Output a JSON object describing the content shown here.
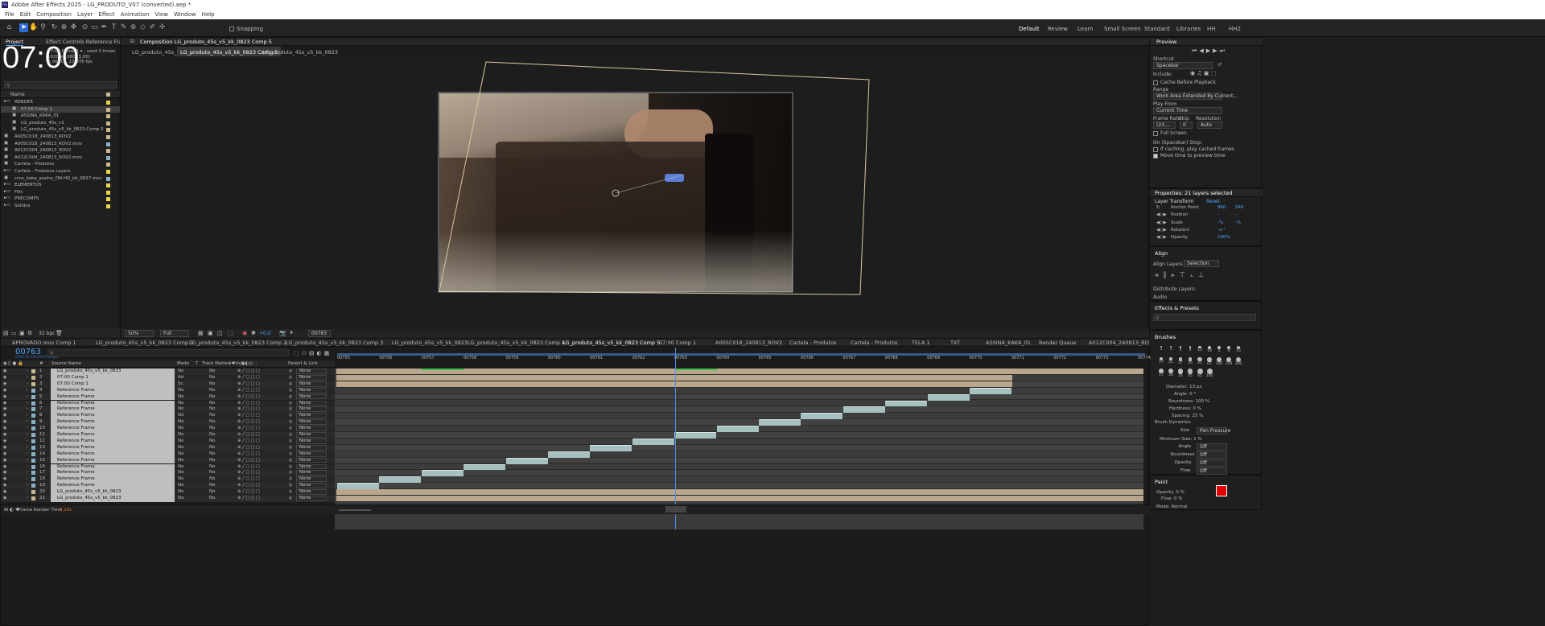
{
  "app": {
    "title": "Adobe After Effects 2025 - LG_PRODUTO_V07 (converted).aep *",
    "logo": "Ae"
  },
  "menu": [
    "File",
    "Edit",
    "Composition",
    "Layer",
    "Effect",
    "Animation",
    "View",
    "Window",
    "Help"
  ],
  "toolbar": {
    "snapping": "Snapping"
  },
  "workspaces": [
    "Default",
    "Review",
    "Learn",
    "Small Screen",
    "Standard",
    "Libraries",
    "HH",
    "HH2"
  ],
  "project": {
    "tabs": [
      "Project",
      "Effect Controls Reference Frame"
    ],
    "timecode": "07:00",
    "info": [
      "07:00 Comp 1 ▾ , used 2 times",
      "1920 x 1080 (1,00)",
      "Δ 00019, 23,976 fps"
    ],
    "col_name": "Name",
    "items": [
      {
        "name": "RENDER",
        "indent": 0,
        "color": "#e8d44d",
        "sel": false
      },
      {
        "name": "07:00 Comp 1",
        "indent": 1,
        "color": "#c9b98d",
        "sel": true
      },
      {
        "name": "ASSINA_KAKA_01",
        "indent": 1,
        "color": "#c9b98d",
        "sel": false
      },
      {
        "name": "LG_produto_45s_v1",
        "indent": 1,
        "color": "#c9b98d",
        "sel": false
      },
      {
        "name": "LG_produto_45s_v5_kk_0823 Comp 5",
        "indent": 1,
        "color": "#c9b98d",
        "sel": false
      },
      {
        "name": "A005C018_240813_ROV2",
        "indent": 0,
        "color": "#c9b98d",
        "sel": false
      },
      {
        "name": "A005C018_240813_ROV2.mov",
        "indent": 0,
        "color": "#8ab0c8",
        "sel": false
      },
      {
        "name": "A012C004_240813_ROV2",
        "indent": 0,
        "color": "#c9b98d",
        "sel": false
      },
      {
        "name": "A012C004_240813_ROV2.mov",
        "indent": 0,
        "color": "#8ab0c8",
        "sel": false
      },
      {
        "name": "Cartela - Produtos",
        "indent": 0,
        "color": "#c9b98d",
        "sel": false
      },
      {
        "name": "Cartela - Produtos Layers",
        "indent": 0,
        "color": "#e8d44d",
        "sel": false
      },
      {
        "name": "crnx_kaka_assina_ON-HD_kk_0827.mov",
        "indent": 0,
        "color": "#8ab0c8",
        "sel": false
      },
      {
        "name": "ELEMENTOS",
        "indent": 0,
        "color": "#e8d44d",
        "sel": false
      },
      {
        "name": "Fills",
        "indent": 0,
        "color": "#e8d44d",
        "sel": false
      },
      {
        "name": "PRECOMPS",
        "indent": 0,
        "color": "#e8d44d",
        "sel": false
      },
      {
        "name": "Sólidos",
        "indent": 0,
        "color": "#e8d44d",
        "sel": false
      }
    ],
    "bpc": "32 bpc"
  },
  "composition": {
    "header": "Composition LG_produto_45s_v5_kk_0823 Comp 5",
    "tabs": [
      "LG_produto_45s_v1",
      "LG_produto_45s_v5_kk_0823 Comp 5",
      "LG_produto_45s_v5_kk_0823"
    ],
    "zoom": "50%",
    "resolution": "Full",
    "exposure": "+0,0",
    "frame": "00763"
  },
  "preview": {
    "title": "Preview",
    "shortcut_label": "Shortcut",
    "shortcut": "Spacebar",
    "include": "Include:",
    "cache": "Cache Before Playback",
    "range_label": "Range",
    "range": "Work Area Extended By Current...",
    "playfrom_label": "Play From",
    "playfrom": "Current Time",
    "fr_label": "Frame Rate",
    "skip_label": "Skip",
    "res_label": "Resolution",
    "fr": "(23,...",
    "skip": "0",
    "res": "Auto",
    "fullscreen": "Full Screen",
    "stop_label": "On (Spacebar) Stop:",
    "stop1": "If caching, play cached frames",
    "stop2": "Move time to preview time"
  },
  "properties": {
    "title": "Properties: 21 layers selected",
    "layer_transform": "Layer Transform",
    "reset": "Reset",
    "rows": [
      {
        "name": "Anchor Point",
        "v1": "960",
        "v2": "540"
      },
      {
        "name": "Position",
        "v1": "-",
        "v2": "-"
      },
      {
        "name": "Scale",
        "v1": "-%",
        "v2": "-%"
      },
      {
        "name": "Rotation",
        "v1": "-x-°",
        "v2": ""
      },
      {
        "name": "Opacity",
        "v1": "100%",
        "v2": ""
      }
    ]
  },
  "align": {
    "title": "Align",
    "to_label": "Align Layers to:",
    "to": "Selection",
    "distribute": "Distribute Layers:",
    "audio": "Audio"
  },
  "effects": {
    "title": "Effects & Presets"
  },
  "brushes": {
    "title": "Brushes",
    "sizes": [
      "1",
      "3",
      "5",
      "9",
      "13",
      "19",
      "5",
      "9",
      "13",
      "17",
      "21",
      "27",
      "35",
      "45",
      "65",
      "100",
      "200",
      "300",
      "17",
      "28",
      "35",
      "45",
      "65",
      "100"
    ],
    "diameter": "Diameter: 13 px",
    "angle": "Angle: 0 °",
    "roundness": "Roundness: 100 %",
    "hardness": "Hardness: 0 %",
    "spacing": "Spacing: 25 %",
    "dynamics": "Brush Dynamics",
    "size_label": "Size",
    "size_val": "Pen Pressure",
    "min_size": "Minimum Size: 1 %",
    "dyn": [
      {
        "l": "Angle",
        "v": "Off"
      },
      {
        "l": "Roundness",
        "v": "Off"
      },
      {
        "l": "Opacity",
        "v": "Off"
      },
      {
        "l": "Flow",
        "v": "Off"
      }
    ]
  },
  "paint": {
    "title": "Paint",
    "opacity": "Opacity: 0 %",
    "flow": "Flow: 0 %",
    "mode": "Mode: Normal",
    "color": "#e00000"
  },
  "timeline": {
    "tabs": [
      "APROVADO.mov Comp 1",
      "LG_produto_45s_v5_kk_0823 Comp 1",
      "LG_produto_45s_v5_kk_0823 Comp 2",
      "LG_produto_45s_v5_kk_0823 Comp 3",
      "LG_produto_45s_v5_kk_0823",
      "LG_produto_45s_v5_kk_0823 Comp 4",
      "LG_produto_45s_v5_kk_0823 Comp 5",
      "07:00 Comp 1",
      "A005C018_240813_ROV2",
      "Cartela - Produtos",
      "Cartela - Produtos",
      "TELA 1",
      "TXT",
      "ASSINA_KAKA_01",
      "Render Queue",
      "A012C004_240813_RO"
    ],
    "timecode": "00763",
    "fps": "0:00:31:19 (23.976 fps)",
    "cols": {
      "source": "Source Name",
      "mode": "Mode",
      "t": "T",
      "matte": "Track Matte",
      "parent": "Parent & Link"
    },
    "ticks": [
      "00755",
      "00756",
      "00757",
      "00758",
      "00759",
      "00760",
      "00761",
      "00762",
      "00763",
      "00764",
      "00765",
      "00766",
      "00767",
      "00768",
      "00769",
      "00770",
      "00771",
      "00772",
      "00773",
      "00774"
    ],
    "layers": [
      {
        "n": "1",
        "name": "LG_produto_45s_v5_kk_0823",
        "mode": "No",
        "matte": "No",
        "parent": "None"
      },
      {
        "n": "2",
        "name": "07:00 Comp 1",
        "mode": "Ad",
        "matte": "No",
        "parent": "None"
      },
      {
        "n": "3",
        "name": "07:00 Comp 1",
        "mode": "Sc",
        "matte": "No",
        "parent": "None"
      },
      {
        "n": "4",
        "name": "Reference Frame",
        "mode": "No",
        "matte": "No",
        "parent": "None"
      },
      {
        "n": "5",
        "name": "Reference Frame",
        "mode": "No",
        "matte": "No",
        "parent": "None"
      },
      {
        "n": "6",
        "name": "Reference Frame",
        "mode": "No",
        "matte": "No",
        "parent": "None"
      },
      {
        "n": "7",
        "name": "Reference Frame",
        "mode": "No",
        "matte": "No",
        "parent": "None"
      },
      {
        "n": "8",
        "name": "Reference Frame",
        "mode": "No",
        "matte": "No",
        "parent": "None"
      },
      {
        "n": "9",
        "name": "Reference Frame",
        "mode": "No",
        "matte": "No",
        "parent": "None"
      },
      {
        "n": "10",
        "name": "Reference Frame",
        "mode": "No",
        "matte": "No",
        "parent": "None"
      },
      {
        "n": "11",
        "name": "Reference Frame",
        "mode": "No",
        "matte": "No",
        "parent": "None"
      },
      {
        "n": "12",
        "name": "Reference Frame",
        "mode": "No",
        "matte": "No",
        "parent": "None"
      },
      {
        "n": "13",
        "name": "Reference Frame",
        "mode": "No",
        "matte": "No",
        "parent": "None"
      },
      {
        "n": "14",
        "name": "Reference Frame",
        "mode": "No",
        "matte": "No",
        "parent": "None"
      },
      {
        "n": "15",
        "name": "Reference Frame",
        "mode": "No",
        "matte": "No",
        "parent": "None"
      },
      {
        "n": "16",
        "name": "Reference Frame",
        "mode": "No",
        "matte": "No",
        "parent": "None"
      },
      {
        "n": "17",
        "name": "Reference Frame",
        "mode": "No",
        "matte": "No",
        "parent": "None"
      },
      {
        "n": "18",
        "name": "Reference Frame",
        "mode": "No",
        "matte": "No",
        "parent": "None"
      },
      {
        "n": "19",
        "name": "Reference Frame",
        "mode": "No",
        "matte": "No",
        "parent": "None"
      },
      {
        "n": "20",
        "name": "LG_produto_45s_v5_kk_0823",
        "mode": "No",
        "matte": "No",
        "parent": "None"
      },
      {
        "n": "21",
        "name": "LG_produto_45s_v5_kk_0823",
        "mode": "No",
        "matte": "No",
        "parent": "None"
      }
    ],
    "render_label": "Frame Render Time",
    "render_time": "3,29s"
  }
}
